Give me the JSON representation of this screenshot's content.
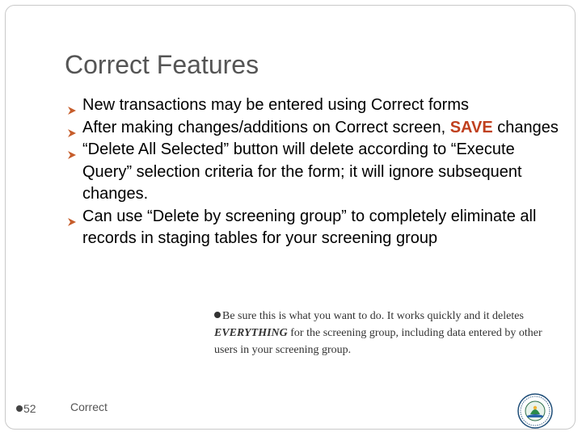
{
  "slide": {
    "title": "Correct Features",
    "bullets": [
      {
        "parts": [
          "New transactions may be entered using Correct forms"
        ]
      },
      {
        "parts": [
          "After making changes/additions on Correct screen, ",
          "SAVE",
          " changes"
        ]
      },
      {
        "parts": [
          "“Delete All Selected” button will delete according to “Execute Query” selection criteria for the form; it will ignore subsequent changes."
        ]
      },
      {
        "parts": [
          "Can use “Delete by screening group” to completely eliminate all records in staging tables for your screening group"
        ]
      }
    ],
    "note": {
      "before": "Be sure this is what you want to do.  It works quickly and it deletes ",
      "emphasis": "EVERYTHING",
      "after": " for the screening group, including data entered by other users in your screening group."
    },
    "footer": {
      "page_number": "52",
      "text": "Correct"
    },
    "colors": {
      "title": "#555555",
      "accent_save": "#c0401e",
      "bullet_marker": "#c65d2b"
    },
    "icons": {
      "bullet": "triangle-arrow-icon",
      "logo": "epa-seal-logo"
    }
  }
}
